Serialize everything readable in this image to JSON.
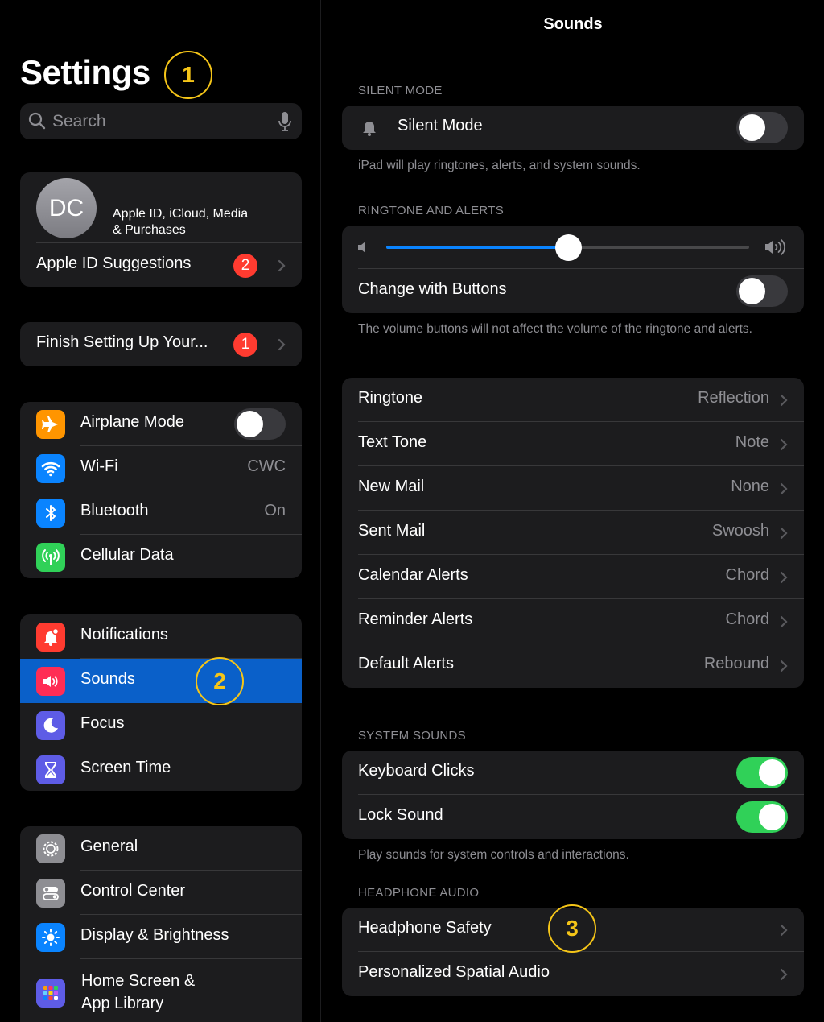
{
  "sidebar": {
    "title": "Settings",
    "search_placeholder": "Search",
    "profile": {
      "initials": "DC",
      "subtitle_line1": "Apple ID, iCloud, Media",
      "subtitle_line2": "& Purchases"
    },
    "apple_id_suggestions": {
      "label": "Apple ID Suggestions",
      "badge": "2"
    },
    "finish_setup": {
      "label": "Finish Setting Up Your...",
      "badge": "1"
    },
    "connectivity": [
      {
        "label": "Airplane Mode",
        "icon": "airplane-icon",
        "color": "#ff9500",
        "value": "",
        "toggle": false
      },
      {
        "label": "Wi-Fi",
        "icon": "wifi-icon",
        "color": "#0a84ff",
        "value": "CWC"
      },
      {
        "label": "Bluetooth",
        "icon": "bluetooth-icon",
        "color": "#0a84ff",
        "value": "On"
      },
      {
        "label": "Cellular Data",
        "icon": "cellular-icon",
        "color": "#30d158",
        "value": ""
      }
    ],
    "alerts": [
      {
        "label": "Notifications",
        "icon": "bell-badge-icon",
        "color": "#ff3b30"
      },
      {
        "label": "Sounds",
        "icon": "speaker-icon",
        "color": "#ff2d55",
        "selected": true
      },
      {
        "label": "Focus",
        "icon": "moon-icon",
        "color": "#5e5ce6"
      },
      {
        "label": "Screen Time",
        "icon": "hourglass-icon",
        "color": "#5e5ce6"
      }
    ],
    "system": [
      {
        "label": "General",
        "icon": "gear-icon",
        "color": "#8e8e93"
      },
      {
        "label": "Control Center",
        "icon": "switches-icon",
        "color": "#8e8e93"
      },
      {
        "label": "Display & Brightness",
        "icon": "sun-icon",
        "color": "#0a84ff"
      },
      {
        "label_line1": "Home Screen &",
        "label_line2": "App Library",
        "icon": "grid-icon",
        "color": "#5e5ce6"
      }
    ]
  },
  "main": {
    "nav_title": "Sounds",
    "silent_mode": {
      "header": "SILENT MODE",
      "label": "Silent Mode",
      "toggle": false,
      "footnote": "iPad will play ringtones, alerts, and system sounds."
    },
    "ringtone_alerts": {
      "header": "RINGTONE AND ALERTS",
      "volume": 0.5,
      "change_with_buttons_label": "Change with Buttons",
      "change_with_buttons_toggle": false,
      "footnote": "The volume buttons will not affect the volume of the ringtone and alerts."
    },
    "tones": [
      {
        "label": "Ringtone",
        "value": "Reflection"
      },
      {
        "label": "Text Tone",
        "value": "Note"
      },
      {
        "label": "New Mail",
        "value": "None"
      },
      {
        "label": "Sent Mail",
        "value": "Swoosh"
      },
      {
        "label": "Calendar Alerts",
        "value": "Chord"
      },
      {
        "label": "Reminder Alerts",
        "value": "Chord"
      },
      {
        "label": "Default Alerts",
        "value": "Rebound"
      }
    ],
    "system_sounds": {
      "header": "SYSTEM SOUNDS",
      "keyboard_clicks_label": "Keyboard Clicks",
      "keyboard_clicks_toggle": true,
      "lock_sound_label": "Lock Sound",
      "lock_sound_toggle": true,
      "footnote": "Play sounds for system controls and interactions."
    },
    "headphone_audio": {
      "header": "HEADPHONE AUDIO",
      "items": [
        {
          "label": "Headphone Safety"
        },
        {
          "label": "Personalized Spatial Audio"
        }
      ]
    }
  },
  "callouts": [
    "1",
    "2",
    "3"
  ],
  "colors": {
    "accent": "#0a84ff",
    "selected_row": "#0a60c9",
    "toggle_on": "#30d158",
    "callout": "#f5c518",
    "badge": "#ff3b30"
  }
}
